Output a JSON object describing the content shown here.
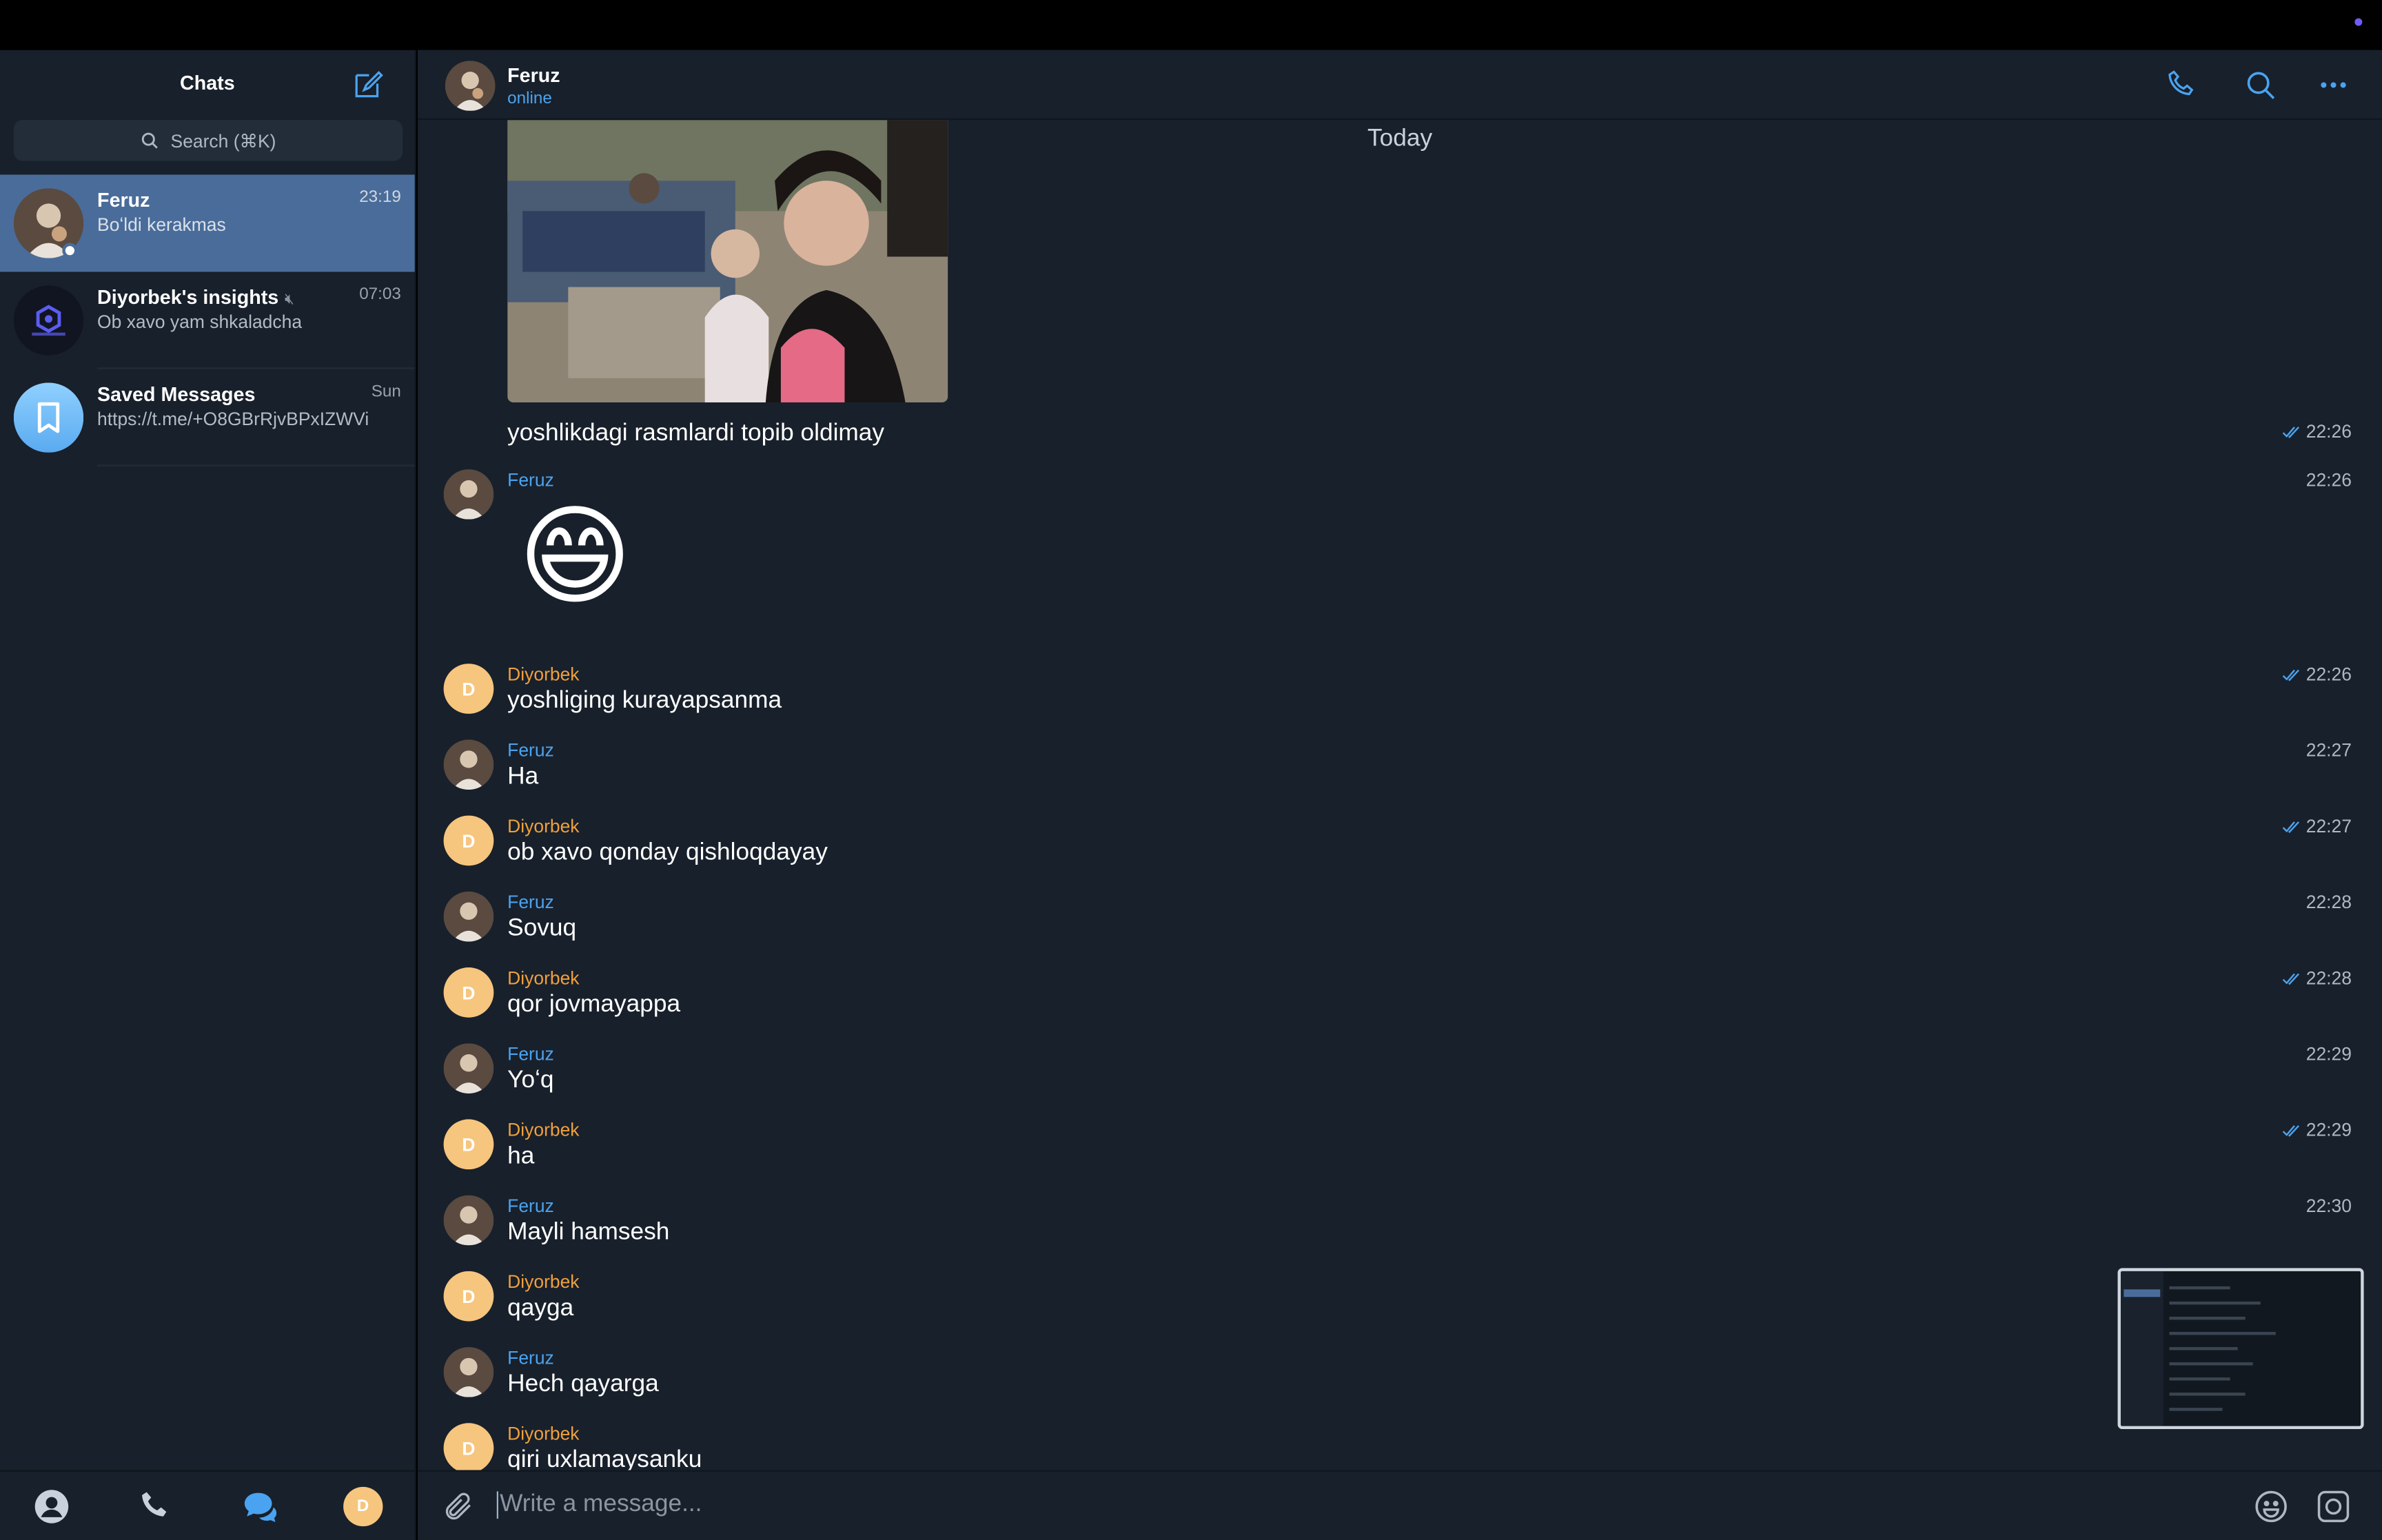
{
  "sidebar": {
    "title": "Chats",
    "search_placeholder": "Search (⌘K)",
    "chats": [
      {
        "name": "Feruz",
        "time": "23:19",
        "preview": "Boʻldi kerakmas"
      },
      {
        "name": "Diyorbek's insights",
        "time": "07:03",
        "preview": "Ob xavo yam shkaladcha"
      },
      {
        "name": "Saved Messages",
        "time": "Sun",
        "preview": "https://t.me/+O8GBrRjvBPxIZWVi"
      }
    ],
    "bottom_avatar_letter": "D"
  },
  "chat": {
    "name": "Feruz",
    "status": "online",
    "date_separator": "Today",
    "photo_caption": "yoshlikdagi rasmlardi topib oldimay",
    "photo_caption_time": "22:26",
    "emoji": "😄",
    "messages": [
      {
        "sender": "Feruz",
        "text": "",
        "time": "22:26"
      },
      {
        "sender": "Diyorbek",
        "avatar": "D",
        "text": "yoshliging kurayapsanma",
        "time": "22:26"
      },
      {
        "sender": "Feruz",
        "text": "Ha",
        "time": "22:27"
      },
      {
        "sender": "Diyorbek",
        "avatar": "D",
        "text": "ob xavo qonday qishloqdayay",
        "time": "22:27"
      },
      {
        "sender": "Feruz",
        "text": "Sovuq",
        "time": "22:28"
      },
      {
        "sender": "Diyorbek",
        "avatar": "D",
        "text": "qor jovmayappa",
        "time": "22:28"
      },
      {
        "sender": "Feruz",
        "text": "Yoʻq",
        "time": "22:29"
      },
      {
        "sender": "Diyorbek",
        "avatar": "D",
        "text": "ha",
        "time": "22:29"
      },
      {
        "sender": "Feruz",
        "text": "Mayli hamsesh",
        "time": "22:30"
      },
      {
        "sender": "Diyorbek",
        "avatar": "D",
        "text": "qayga",
        "time": ""
      },
      {
        "sender": "Feruz",
        "text": "Hech qayarga",
        "time": ""
      },
      {
        "sender": "Diyorbek",
        "avatar": "D",
        "text": "qiri  uxlamaysanku",
        "time": ""
      }
    ],
    "composer_placeholder": "Write a message..."
  },
  "colors": {
    "accent": "#4aa3f0",
    "orange_sender": "#f0a03c",
    "active_chat": "#4a6c9a",
    "background": "#18202b"
  }
}
